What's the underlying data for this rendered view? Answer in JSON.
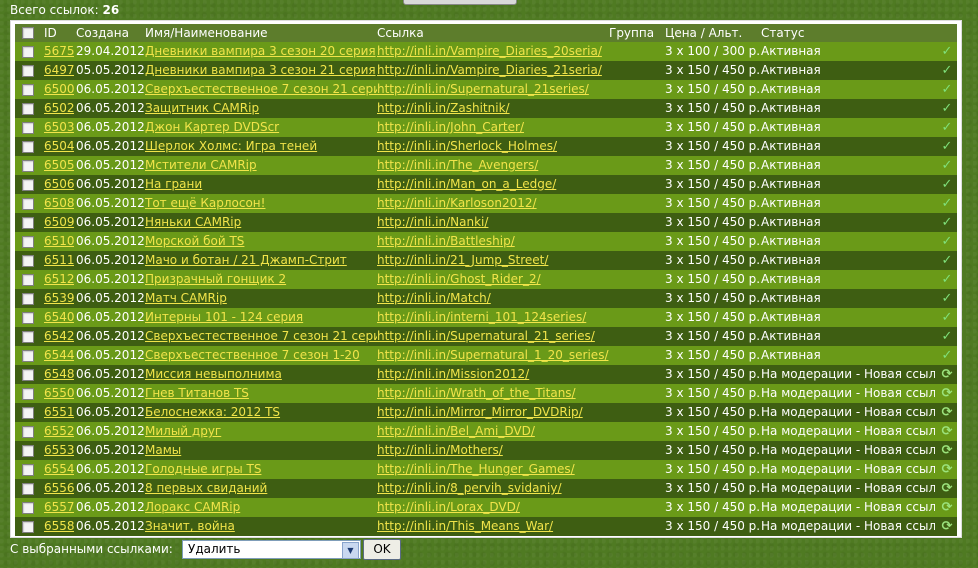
{
  "summary": {
    "label": "Всего ссылок:",
    "count": "26"
  },
  "columns": {
    "id": "ID",
    "created": "Создана",
    "name": "Имя/Наименование",
    "link": "Ссылка",
    "group": "Группа",
    "price": "Цена / Альт.",
    "status": "Статус"
  },
  "rows": [
    {
      "id": "5675",
      "date": "29.04.2012",
      "name": "Дневники вампира 3 сезон 20 серия",
      "link": "http://inli.in/Vampire_Diaries_20seria/",
      "price": "3 x 100 / 300 р.",
      "status": "Активная",
      "icon": "ok"
    },
    {
      "id": "6497",
      "date": "05.05.2012",
      "name": "Дневники вампира 3 сезон 21 серия",
      "link": "http://inli.in/Vampire_Diaries_21seria/",
      "price": "3 x 150 / 450 р.",
      "status": "Активная",
      "icon": "ok"
    },
    {
      "id": "6500",
      "date": "06.05.2012",
      "name": "Сверхъестественное 7 сезон 21 серия",
      "link": "http://inli.in/Supernatural_21series/",
      "price": "3 x 150 / 450 р.",
      "status": "Активная",
      "icon": "ok"
    },
    {
      "id": "6502",
      "date": "06.05.2012",
      "name": "Защитник CAMRip",
      "link": "http://inli.in/Zashitnik/",
      "price": "3 x 150 / 450 р.",
      "status": "Активная",
      "icon": "ok"
    },
    {
      "id": "6503",
      "date": "06.05.2012",
      "name": "Джон Картер DVDScr",
      "link": "http://inli.in/John_Carter/",
      "price": "3 x 150 / 450 р.",
      "status": "Активная",
      "icon": "ok"
    },
    {
      "id": "6504",
      "date": "06.05.2012",
      "name": "Шерлок Холмс: Игра теней",
      "link": "http://inli.in/Sherlock_Holmes/",
      "price": "3 x 150 / 450 р.",
      "status": "Активная",
      "icon": "ok"
    },
    {
      "id": "6505",
      "date": "06.05.2012",
      "name": "Мстители CAMRip",
      "link": "http://inli.in/The_Avengers/",
      "price": "3 x 150 / 450 р.",
      "status": "Активная",
      "icon": "ok"
    },
    {
      "id": "6506",
      "date": "06.05.2012",
      "name": "На грани",
      "link": "http://inli.in/Man_on_a_Ledge/",
      "price": "3 x 150 / 450 р.",
      "status": "Активная",
      "icon": "ok"
    },
    {
      "id": "6508",
      "date": "06.05.2012",
      "name": "Тот ещё Карлосон!",
      "link": "http://inli.in/Karloson2012/",
      "price": "3 x 150 / 450 р.",
      "status": "Активная",
      "icon": "ok"
    },
    {
      "id": "6509",
      "date": "06.05.2012",
      "name": "Няньки CAMRip",
      "link": "http://inli.in/Nanki/",
      "price": "3 x 150 / 450 р.",
      "status": "Активная",
      "icon": "ok"
    },
    {
      "id": "6510",
      "date": "06.05.2012",
      "name": "Морской бой TS",
      "link": "http://inli.in/Battleship/",
      "price": "3 x 150 / 450 р.",
      "status": "Активная",
      "icon": "ok"
    },
    {
      "id": "6511",
      "date": "06.05.2012",
      "name": "Мачо и ботан / 21 Джамп-Стрит",
      "link": "http://inli.in/21_Jump_Street/",
      "price": "3 x 150 / 450 р.",
      "status": "Активная",
      "icon": "ok"
    },
    {
      "id": "6512",
      "date": "06.05.2012",
      "name": "Призрачный гонщик 2",
      "link": "http://inli.in/Ghost_Rider_2/",
      "price": "3 x 150 / 450 р.",
      "status": "Активная",
      "icon": "ok"
    },
    {
      "id": "6539",
      "date": "06.05.2012",
      "name": "Матч CAMRip",
      "link": "http://inli.in/Match/",
      "price": "3 x 150 / 450 р.",
      "status": "Активная",
      "icon": "ok"
    },
    {
      "id": "6540",
      "date": "06.05.2012",
      "name": "Интерны 101 - 124 серия",
      "link": "http://inli.in/interni_101_124series/",
      "price": "3 x 150 / 450 р.",
      "status": "Активная",
      "icon": "ok"
    },
    {
      "id": "6542",
      "date": "06.05.2012",
      "name": "Сверхъестественное 7 сезон 21 серия",
      "link": "http://inli.in/Supernatural_21_series/",
      "price": "3 x 150 / 450 р.",
      "status": "Активная",
      "icon": "ok"
    },
    {
      "id": "6544",
      "date": "06.05.2012",
      "name": "Сверхъестественное 7 сезон 1-20",
      "link": "http://inli.in/Supernatural_1_20_series/",
      "price": "3 x 150 / 450 р.",
      "status": "Активная",
      "icon": "ok"
    },
    {
      "id": "6548",
      "date": "06.05.2012",
      "name": "Миссия невыполнима",
      "link": "http://inli.in/Mission2012/",
      "price": "3 x 150 / 450 р.",
      "status": "На модерации - Новая ссылка",
      "icon": "refresh"
    },
    {
      "id": "6550",
      "date": "06.05.2012",
      "name": "Гнев Титанов TS",
      "link": "http://inli.in/Wrath_of_the_Titans/",
      "price": "3 x 150 / 450 р.",
      "status": "На модерации - Новая ссылка",
      "icon": "refresh"
    },
    {
      "id": "6551",
      "date": "06.05.2012",
      "name": "Белоснежка: 2012 TS",
      "link": "http://inli.in/Mirror_Mirror_DVDRip/",
      "price": "3 x 150 / 450 р.",
      "status": "На модерации - Новая ссылка",
      "icon": "refresh"
    },
    {
      "id": "6552",
      "date": "06.05.2012",
      "name": "Милый друг",
      "link": "http://inli.in/Bel_Ami_DVD/",
      "price": "3 x 150 / 450 р.",
      "status": "На модерации - Новая ссылка",
      "icon": "refresh"
    },
    {
      "id": "6553",
      "date": "06.05.2012",
      "name": "Мамы",
      "link": "http://inli.in/Mothers/",
      "price": "3 x 150 / 450 р.",
      "status": "На модерации - Новая ссылка",
      "icon": "refresh"
    },
    {
      "id": "6554",
      "date": "06.05.2012",
      "name": "Голодные игры TS",
      "link": "http://inli.in/The_Hunger_Games/",
      "price": "3 x 150 / 450 р.",
      "status": "На модерации - Новая ссылка",
      "icon": "refresh"
    },
    {
      "id": "6556",
      "date": "06.05.2012",
      "name": "8 первых свиданий",
      "link": "http://inli.in/8_pervih_svidaniy/",
      "price": "3 x 150 / 450 р.",
      "status": "На модерации - Новая ссылка",
      "icon": "refresh"
    },
    {
      "id": "6557",
      "date": "06.05.2012",
      "name": "Лоракс CAMRip",
      "link": "http://inli.in/Lorax_DVD/",
      "price": "3 x 150 / 450 р.",
      "status": "На модерации - Новая ссылка",
      "icon": "refresh"
    },
    {
      "id": "6558",
      "date": "06.05.2012",
      "name": "Значит, война",
      "link": "http://inli.in/This_Means_War/",
      "price": "3 x 150 / 450 р.",
      "status": "На модерации - Новая ссылка",
      "icon": "refresh"
    }
  ],
  "footer": {
    "label": "С выбранными ссылками:",
    "action_value": "Удалить",
    "ok_label": "OK"
  },
  "icons": {
    "ok": "checkmark-icon",
    "refresh": "refresh-icon"
  },
  "colors": {
    "row_light": "#6a9a18",
    "row_dark": "#3e5e12",
    "link": "#f1e44a",
    "background": "#4f7a22"
  }
}
